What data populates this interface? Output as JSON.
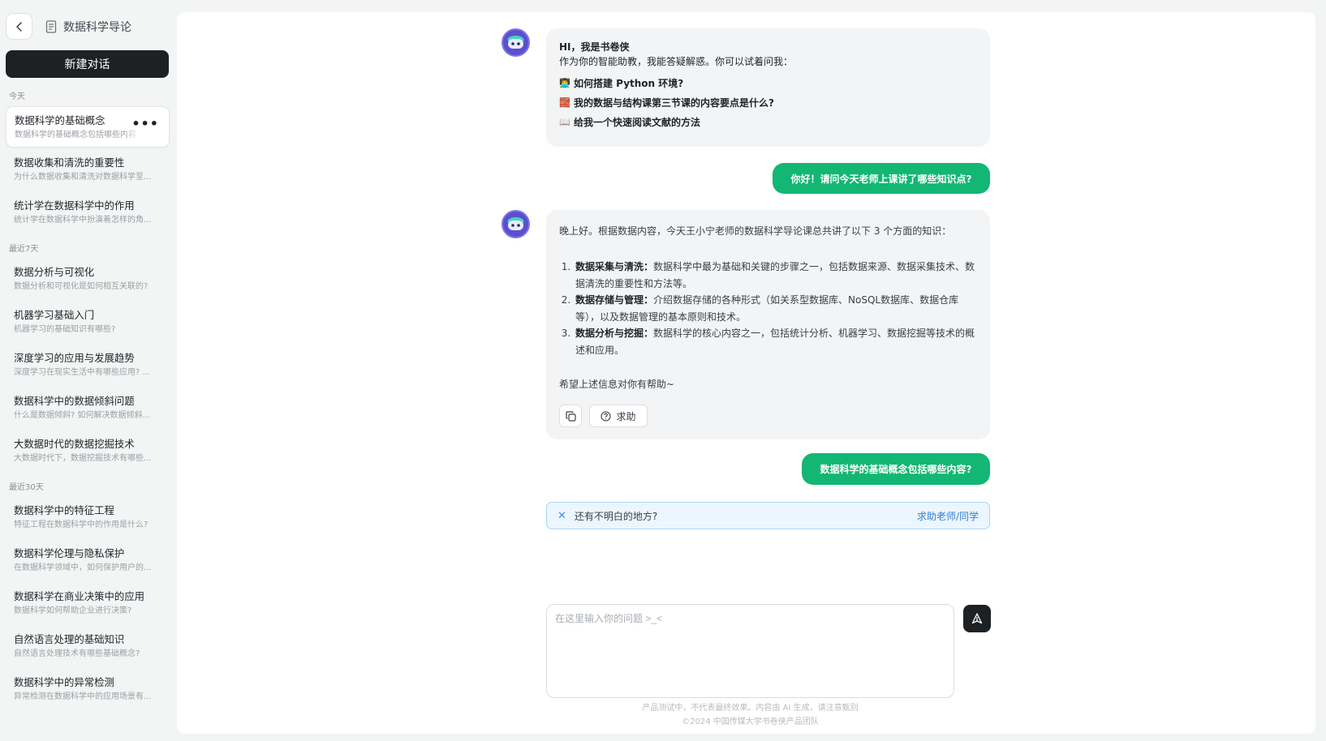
{
  "sidebar": {
    "course_title": "数据科学导论",
    "new_chat_label": "新建对话",
    "groups": [
      {
        "label": "今天",
        "items": [
          {
            "title": "数据科学的基础概念",
            "subtitle": "数据科学的基础概念包括哪些内容",
            "active": true
          },
          {
            "title": "数据收集和清洗的重要性",
            "subtitle": "为什么数据收集和清洗对数据科学至..."
          },
          {
            "title": "统计学在数据科学中的作用",
            "subtitle": "统计学在数据科学中扮演着怎样的角..."
          }
        ]
      },
      {
        "label": "最近7天",
        "items": [
          {
            "title": "数据分析与可视化",
            "subtitle": "数据分析和可视化是如何相互关联的?"
          },
          {
            "title": "机器学习基础入门",
            "subtitle": "机器学习的基础知识有哪些?"
          },
          {
            "title": "深度学习的应用与发展趋势",
            "subtitle": "深度学习在现实生活中有哪些应用? ..."
          },
          {
            "title": "数据科学中的数据倾斜问题",
            "subtitle": "什么是数据倾斜? 如何解决数据倾斜..."
          },
          {
            "title": "大数据时代的数据挖掘技术",
            "subtitle": "大数据时代下，数据挖掘技术有哪些..."
          }
        ]
      },
      {
        "label": "最近30天",
        "items": [
          {
            "title": "数据科学中的特征工程",
            "subtitle": "特征工程在数据科学中的作用是什么?"
          },
          {
            "title": "数据科学伦理与隐私保护",
            "subtitle": "在数据科学领域中，如何保护用户的..."
          },
          {
            "title": "数据科学在商业决策中的应用",
            "subtitle": "数据科学如何帮助企业进行决策?"
          },
          {
            "title": "自然语言处理的基础知识",
            "subtitle": "自然语言处理技术有哪些基础概念?"
          },
          {
            "title": "数据科学中的异常检测",
            "subtitle": "异常检测在数据科学中的应用场景有..."
          }
        ]
      }
    ]
  },
  "chat": {
    "welcome": {
      "greeting": "HI，我是书卷侠",
      "intro": "作为你的智能助教，我能答疑解惑。你可以试着问我：",
      "suggestions": [
        {
          "icon": "person-icon",
          "emoji": "👨‍💻",
          "text": "如何搭建 Python 环境?"
        },
        {
          "icon": "bricks-icon",
          "emoji": "🧱",
          "text": "我的数据与结构课第三节课的内容要点是什么?"
        },
        {
          "icon": "book-icon",
          "emoji": "📖",
          "text": "给我一个快速阅读文献的方法"
        }
      ]
    },
    "user_message_1": "你好！请问今天老师上课讲了哪些知识点?",
    "answer": {
      "intro": "晚上好。根据数据内容，今天王小宁老师的数据科学导论课总共讲了以下 3 个方面的知识：",
      "points": [
        {
          "label": "数据采集与清洗：",
          "text": "数据科学中最为基础和关键的步骤之一，包括数据来源、数据采集技术、数据清洗的重要性和方法等。"
        },
        {
          "label": "数据存储与管理：",
          "text": "介绍数据存储的各种形式（如关系型数据库、NoSQL数据库、数据仓库等），以及数据管理的基本原则和技术。"
        },
        {
          "label": "数据分析与挖掘：",
          "text": "数据科学的核心内容之一，包括统计分析、机器学习、数据挖掘等技术的概述和应用。"
        }
      ],
      "closing": "希望上述信息对你有帮助~",
      "help_label": "求助"
    },
    "user_message_2": "数据科学的基础概念包括哪些内容?",
    "notice": {
      "text": "还有不明白的地方?",
      "link": "求助老师/同学"
    },
    "input_placeholder": "在这里输入你的问题 >_<",
    "footer_disclaimer": "产品测试中，不代表最终效果。内容由 AI 生成，请注意甄别",
    "footer_copyright": "©2024 中国传媒大学书卷侠产品团队"
  },
  "colors": {
    "accent_green": "#13b673",
    "dark_button": "#1e2124",
    "notice_bg": "#ebf6fe",
    "link_blue": "#2f7fd1"
  }
}
